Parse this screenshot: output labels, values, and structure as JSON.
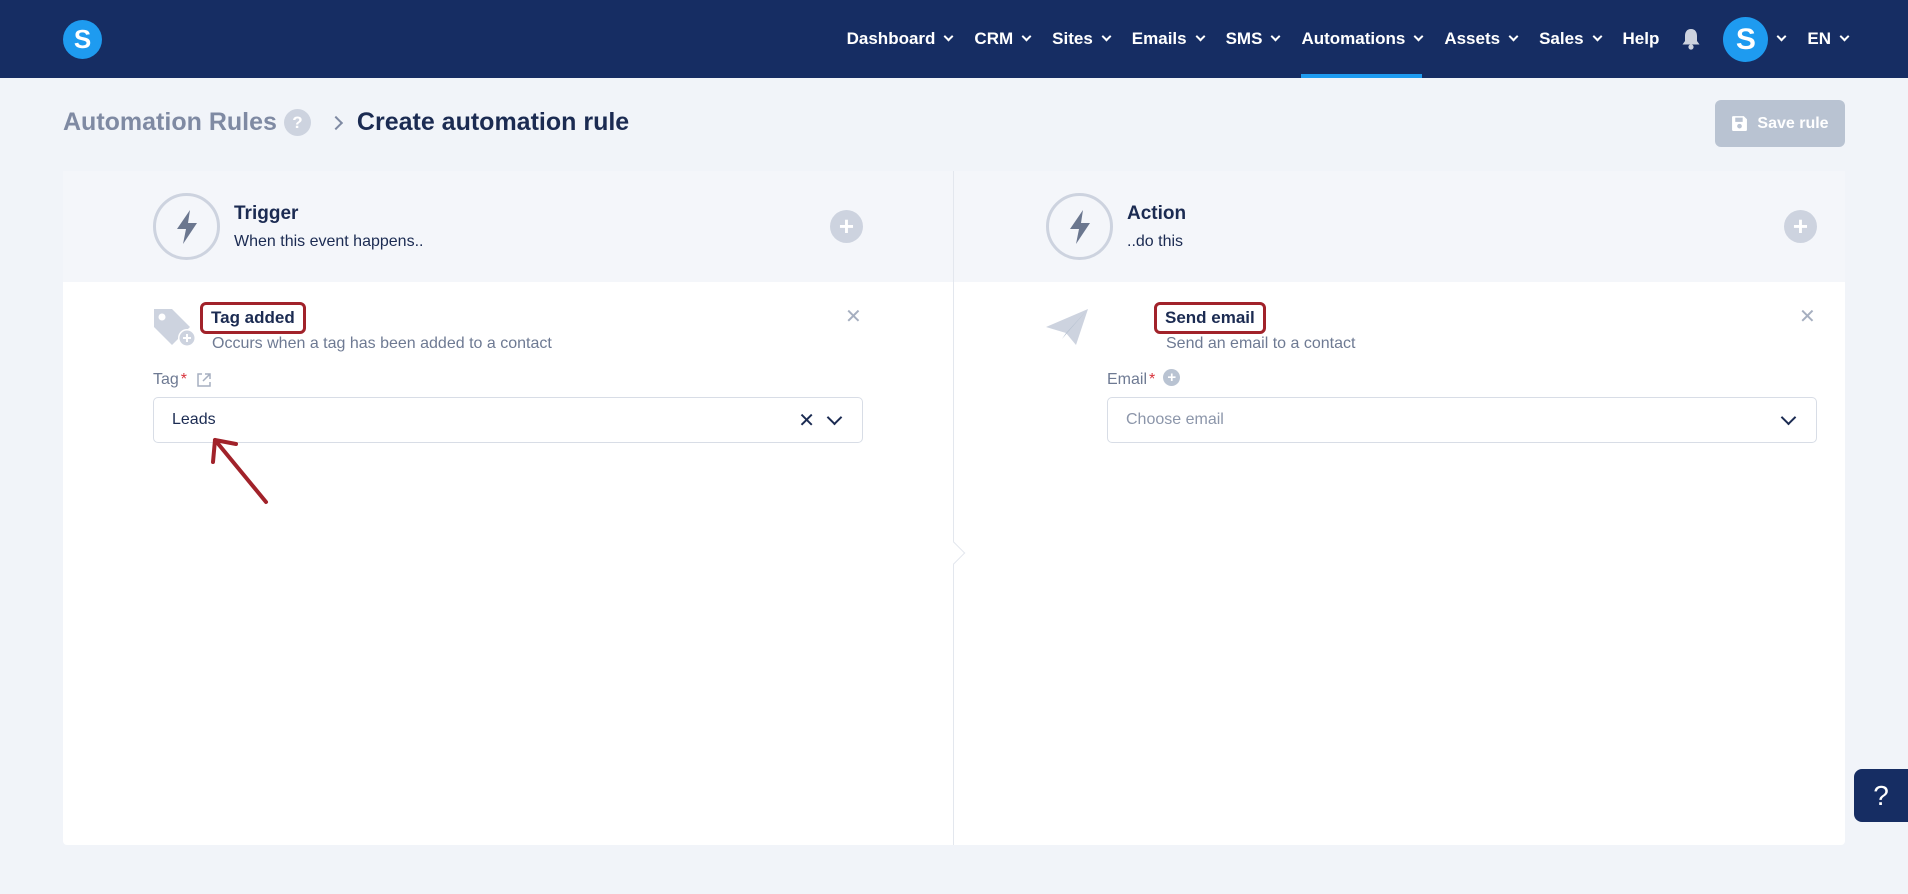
{
  "nav": {
    "items": [
      {
        "label": "Dashboard",
        "has_menu": true,
        "active": false
      },
      {
        "label": "CRM",
        "has_menu": true,
        "active": false
      },
      {
        "label": "Sites",
        "has_menu": true,
        "active": false
      },
      {
        "label": "Emails",
        "has_menu": true,
        "active": false
      },
      {
        "label": "SMS",
        "has_menu": true,
        "active": false
      },
      {
        "label": "Automations",
        "has_menu": true,
        "active": true
      },
      {
        "label": "Assets",
        "has_menu": true,
        "active": false
      },
      {
        "label": "Sales",
        "has_menu": true,
        "active": false
      },
      {
        "label": "Help",
        "has_menu": false,
        "active": false
      }
    ],
    "logo_letter": "S",
    "avatar_letter": "S",
    "language": "EN"
  },
  "header": {
    "breadcrumb_parent": "Automation Rules",
    "help_label": "?",
    "page_title": "Create automation rule",
    "save_label": "Save rule"
  },
  "trigger": {
    "title": "Trigger",
    "subtitle": "When this event happens..",
    "item_title": "Tag added",
    "item_desc": "Occurs when a tag has been added to a contact",
    "field_label": "Tag",
    "required_mark": "*",
    "field_value": "Leads"
  },
  "action": {
    "title": "Action",
    "subtitle": "..do this",
    "item_title": "Send email",
    "item_desc": "Send an email to a contact",
    "field_label": "Email",
    "required_mark": "*",
    "field_placeholder": "Choose email"
  },
  "help_tab_label": "?",
  "colors": {
    "nav_bg": "#162d63",
    "accent": "#1e9bf0",
    "annotation": "#a1222a",
    "page_bg": "#f1f4f9"
  }
}
